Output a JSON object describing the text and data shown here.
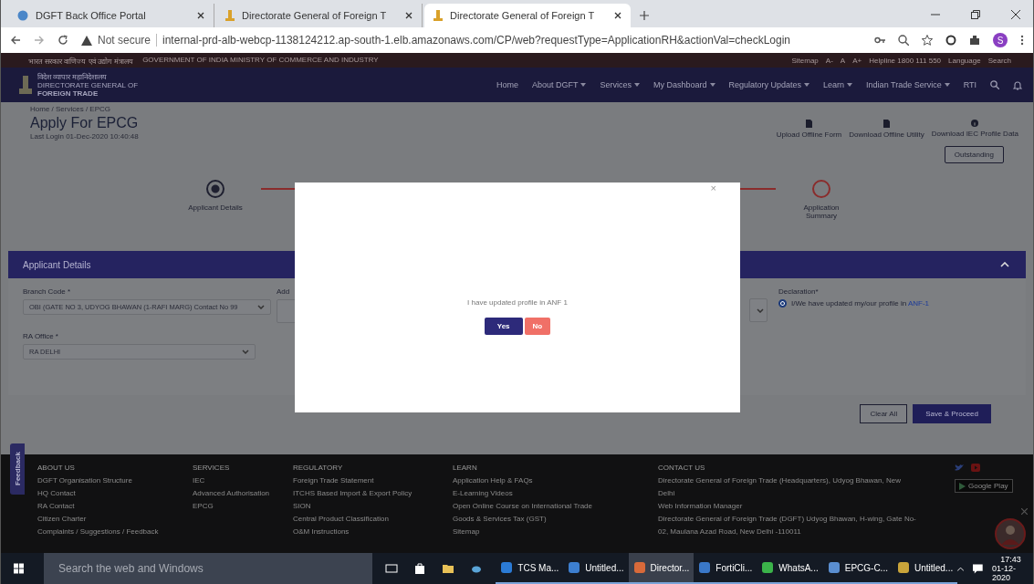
{
  "browser": {
    "tabs": [
      {
        "title": "DGFT Back Office Portal",
        "selected": false
      },
      {
        "title": "Directorate General of Foreign T",
        "selected": false
      },
      {
        "title": "Directorate General of Foreign T",
        "selected": true
      }
    ],
    "security": "Not secure",
    "url": "internal-prd-alb-webcp-1138124212.ap-south-1.elb.amazonaws.com/CP/web?requestType=ApplicationRH&actionVal=checkLogin",
    "profile_initial": "S"
  },
  "site": {
    "strip_left": [
      "भारत सरकार  वाणिज्य एवं उद्योग मंत्रालय",
      "GOVERNMENT OF INDIA  MINISTRY OF COMMERCE AND INDUSTRY"
    ],
    "strip_right": [
      "Sitemap",
      "A-",
      "A",
      "A+",
      "Helpline 1800 111 550",
      "Language",
      "Search"
    ],
    "logo": [
      "विदेश व्यापार महानिदेशालय",
      "DIRECTORATE GENERAL OF",
      "FOREIGN TRADE"
    ],
    "nav": [
      {
        "label": "Home",
        "dropdown": false
      },
      {
        "label": "About DGFT",
        "dropdown": true
      },
      {
        "label": "Services",
        "dropdown": true
      },
      {
        "label": "My Dashboard",
        "dropdown": true
      },
      {
        "label": "Regulatory Updates",
        "dropdown": true
      },
      {
        "label": "Learn",
        "dropdown": true
      },
      {
        "label": "Indian Trade Service",
        "dropdown": true
      },
      {
        "label": "RTI",
        "dropdown": false
      }
    ]
  },
  "page": {
    "breadcrumb": "Home / Services / EPCG",
    "title": "Apply For EPCG",
    "last_login": "Last Login 01-Dec-2020 10:40:48",
    "actions": [
      {
        "label": "Upload Offline Form",
        "kind": "file"
      },
      {
        "label": "Download Offline Utility",
        "kind": "file"
      },
      {
        "label": "Download IEC Profile Data",
        "kind": "info"
      }
    ],
    "outstanding": "Outstanding",
    "steps": [
      {
        "label": "Applicant Details",
        "selected": true
      },
      {
        "label": "Application Summary",
        "selected": false
      }
    ],
    "card_title": "Applicant Details",
    "branch": {
      "label": "Branch Code *",
      "value": "OBI (GATE NO 3, UDYOG BHAWAN (1-RAFI MARG) Contact No 99"
    },
    "second_label": "Add",
    "ra": {
      "label": "RA Office *",
      "value": "RA DELHI"
    },
    "declaration": {
      "label": "Declaration*",
      "text": "I/We have updated my/our profile in ",
      "link": "ANF-1",
      "checked": true
    },
    "buttons": [
      "Clear All",
      "Save & Proceed"
    ],
    "feedback": "Feedback"
  },
  "footer": {
    "columns": [
      {
        "heading": "ABOUT US",
        "links": [
          "DGFT Organisation Structure",
          "HQ Contact",
          "RA Contact",
          "Citizen Charter",
          "Complaints / Suggestions / Feedback"
        ]
      },
      {
        "heading": "SERVICES",
        "links": [
          "IEC",
          "Advanced Authorisation",
          "EPCG"
        ]
      },
      {
        "heading": "REGULATORY",
        "links": [
          "Foreign Trade Statement",
          "ITCHS Based Import & Export Policy",
          "SION",
          "Central Product Classification",
          "O&M Instructions"
        ]
      },
      {
        "heading": "LEARN",
        "links": [
          "Application Help & FAQs",
          "E-Learning Videos",
          "Open Online Course on International Trade",
          "Goods & Services Tax (GST)",
          "Sitemap"
        ]
      },
      {
        "heading": "CONTACT US",
        "links": [
          "Directorate General of Foreign Trade (Headquarters), Udyog Bhawan, New",
          "Delhi",
          "Web Information Manager",
          "Directorate General of Foreign Trade (DGFT) Udyog Bhawan, H-wing, Gate No-",
          "02, Maulana Azad Road, New Delhi -110011"
        ]
      }
    ],
    "google_play": "Google Play"
  },
  "modal": {
    "close": "×",
    "message": "I have updated profile in ANF 1",
    "buttons": [
      {
        "label": "Yes",
        "kind": "primary"
      },
      {
        "label": "No",
        "kind": "danger"
      }
    ]
  },
  "taskbar": {
    "search": "Search the web and Windows",
    "apps": [
      {
        "label": "TCS Ma...",
        "selected": false
      },
      {
        "label": "Untitled...",
        "selected": false
      },
      {
        "label": "Director...",
        "selected": true
      },
      {
        "label": "FortiCli...",
        "selected": false
      },
      {
        "label": "WhatsA...",
        "selected": false
      },
      {
        "label": "EPCG-C...",
        "selected": false
      },
      {
        "label": "Untitled...",
        "selected": false
      }
    ],
    "time": "17:43",
    "date": "01-12-2020"
  }
}
